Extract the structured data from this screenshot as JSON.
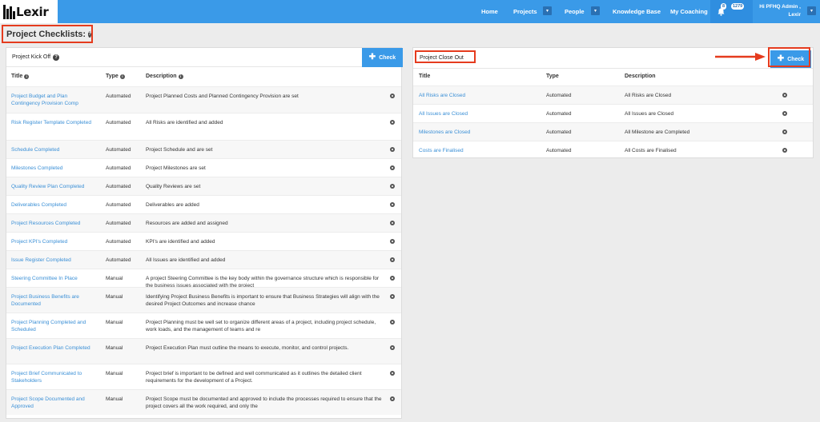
{
  "app": {
    "logo_text": "Lexir"
  },
  "nav": {
    "home": "Home",
    "projects": "Projects",
    "people": "People",
    "knowledge_base": "Knowledge Base",
    "my_coaching": "My Coaching",
    "notif_count_a": "8",
    "notif_count_b": "1279",
    "user_greeting": "Hi PFHQ Admin ,",
    "user_org": "Lexir",
    "caret": "▾"
  },
  "page": {
    "title": "Project Checklists:",
    "help": "?"
  },
  "kickoff": {
    "title": "Project Kick Off",
    "check_label": "Check",
    "columns": {
      "title": "Title",
      "type": "Type",
      "description": "Description"
    },
    "rows": [
      {
        "title": "Project Budget and Plan Contingency Provision Comp",
        "type": "Automated",
        "description": "Project Planned Costs and Planned Contingency Provision are set"
      },
      {
        "title": "Risk Register Template Completed",
        "type": "Automated",
        "description": "All Risks are identified and added"
      },
      {
        "title": "Schedule Completed",
        "type": "Automated",
        "description": "Project Schedule and are set"
      },
      {
        "title": "Milestones Completed",
        "type": "Automated",
        "description": "Project Milestones are set"
      },
      {
        "title": "Quality Review Plan Completed",
        "type": "Automated",
        "description": "Quality Reviews are set"
      },
      {
        "title": "Deliverables Completed",
        "type": "Automated",
        "description": "Deliverables are added"
      },
      {
        "title": "Project Resources Completed",
        "type": "Automated",
        "description": "Resources are added and assigned"
      },
      {
        "title": "Project KPI's Completed",
        "type": "Automated",
        "description": "KPI's are identified and added"
      },
      {
        "title": "Issue Register Completed",
        "type": "Automated",
        "description": "All Issues are identified and added"
      },
      {
        "title": "Steering Committee In Place",
        "type": "Manual",
        "description": "A project Steering Committee is the key body within the governance structure which is responsible for the business issues associated with the project"
      },
      {
        "title": "Project Business Benefits are Documented",
        "type": "Manual",
        "description": "Identifying Project Business Benefits is important to ensure that Business Strategies will align with the desired Project Outcomes and increase chance"
      },
      {
        "title": "Project Planning Completed and Scheduled",
        "type": "Manual",
        "description": "Project Planning must be well set to organize different areas of a project, including project schedule, work loads, and the management of teams and re"
      },
      {
        "title": "Project Execution Plan Completed",
        "type": "Manual",
        "description": "Project Execution Plan must outline the means to execute, monitor, and control projects."
      },
      {
        "title": "Project Brief Communicated to Stakeholders",
        "type": "Manual",
        "description": "Project brief is important to be defined and well communicated as it outlines the detailed client requirements for the development of a Project."
      },
      {
        "title": "Project Scope Documented and Approved",
        "type": "Manual",
        "description": "Project Scope must be documented and approved to include the processes required to ensure that the project covers all the work required, and only the"
      }
    ]
  },
  "closeout": {
    "title": "Project Close Out",
    "check_label": "Check",
    "columns": {
      "title": "Title",
      "type": "Type",
      "description": "Description"
    },
    "rows": [
      {
        "title": "All Risks are Closed",
        "type": "Automated",
        "description": "All Risks are Closed"
      },
      {
        "title": "All Issues are Closed",
        "type": "Automated",
        "description": "All Issues are Closed"
      },
      {
        "title": "Milestones are Closed",
        "type": "Automated",
        "description": "All Milestone are Completed"
      },
      {
        "title": "Costs are Finalised",
        "type": "Automated",
        "description": "All Costs are Finalised"
      }
    ]
  },
  "colors": {
    "accent": "#3a9ae8",
    "link": "#3a8fd6",
    "highlight": "#e53b1e"
  }
}
